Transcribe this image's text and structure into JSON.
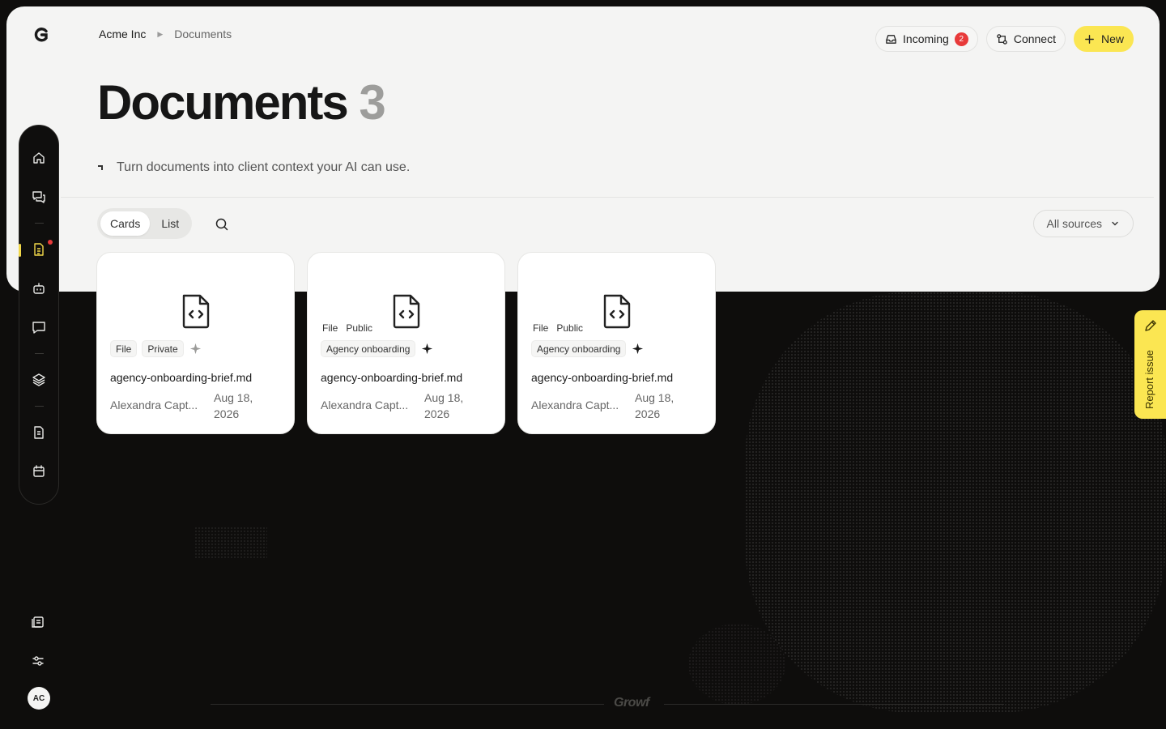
{
  "breadcrumb": {
    "org": "Acme Inc",
    "page": "Documents"
  },
  "header": {
    "incoming_label": "Incoming",
    "incoming_count": "2",
    "connect_label": "Connect",
    "new_label": "New"
  },
  "page": {
    "title": "Documents",
    "count": "3",
    "subtitle": "Turn documents into client context your AI can use."
  },
  "toolbar": {
    "view_cards": "Cards",
    "view_list": "List",
    "active_view": "Cards",
    "sources_label": "All sources"
  },
  "cards": [
    {
      "type": "File",
      "visibility": "Private",
      "collection": "",
      "name": "agency-onboarding-brief.md",
      "owner": "Alexandra Capt...",
      "date": "Aug 18, 2026"
    },
    {
      "type": "File",
      "visibility": "Public",
      "collection": "Agency onboarding",
      "name": "agency-onboarding-brief.md",
      "owner": "Alexandra Capt...",
      "date": "Aug 18, 2026"
    },
    {
      "type": "File",
      "visibility": "Public",
      "collection": "Agency onboarding",
      "name": "agency-onboarding-brief.md",
      "owner": "Alexandra Capt...",
      "date": "Aug 18, 2026"
    }
  ],
  "sidebar": {
    "items": [
      "home-icon",
      "chats-icon",
      "documents-icon",
      "agents-icon",
      "messages-icon",
      "layers-icon",
      "notes-icon",
      "calendar-icon"
    ],
    "active": "documents-icon",
    "bottom": [
      "changelog-icon",
      "settings-icon"
    ],
    "avatar": "AC"
  },
  "report_issue": "Report issue",
  "footer_brand": "Growf",
  "colors": {
    "accent": "#fbe652",
    "badge": "#e83a3a",
    "background": "#0e0d0c",
    "panel": "#f4f4f3"
  }
}
